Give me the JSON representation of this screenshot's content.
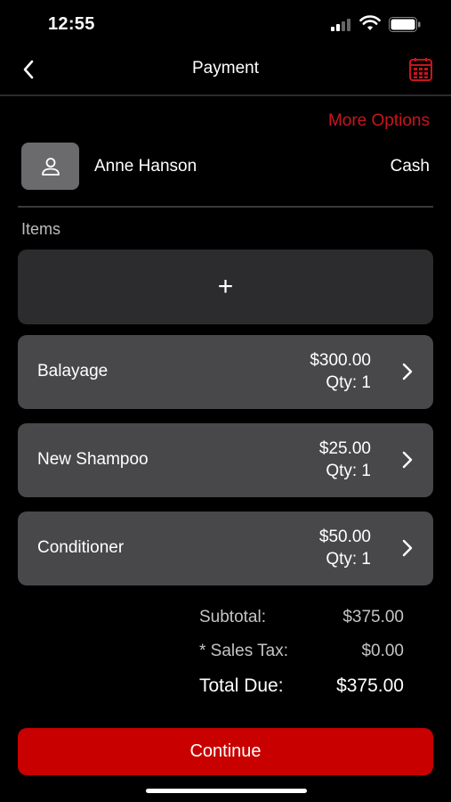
{
  "status_bar": {
    "time": "12:55"
  },
  "nav": {
    "title": "Payment"
  },
  "more_options": "More Options",
  "customer": {
    "name": "Anne Hanson",
    "payment_method": "Cash"
  },
  "items_label": "Items",
  "add_item_symbol": "+",
  "items": [
    {
      "name": "Balayage",
      "price": "$300.00",
      "qty": "Qty: 1"
    },
    {
      "name": "New Shampoo",
      "price": "$25.00",
      "qty": "Qty: 1"
    },
    {
      "name": "Conditioner",
      "price": "$50.00",
      "qty": "Qty: 1"
    }
  ],
  "totals": {
    "subtotal_label": "Subtotal:",
    "subtotal_value": "$375.00",
    "tax_label": "* Sales Tax:",
    "tax_value": "$0.00",
    "due_label": "Total Due:",
    "due_value": "$375.00"
  },
  "continue_label": "Continue",
  "colors": {
    "accent": "#c8161c",
    "button": "#c80000",
    "card": "#48484a",
    "add_card": "#2c2c2e"
  },
  "icons": {
    "back": "chevron-left-icon",
    "calendar": "calendar-icon",
    "avatar": "person-icon",
    "chevron": "chevron-right-icon",
    "signal": "cellular-signal-icon",
    "wifi": "wifi-icon",
    "battery": "battery-icon"
  }
}
